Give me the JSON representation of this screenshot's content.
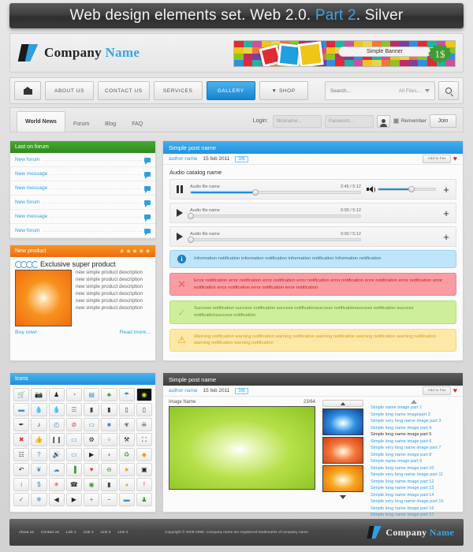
{
  "titlebar": {
    "part1": "Web design elements set. Web 2.0. ",
    "part2": "Part 2",
    "part3": ". Silver"
  },
  "brand": {
    "company": "Company ",
    "name": "Name"
  },
  "banner": {
    "caption": "Simple Banner",
    "price": "1$"
  },
  "nav": {
    "home_icon": "home-icon",
    "items": [
      {
        "label": "ABOUT US",
        "active": false
      },
      {
        "label": "CONTACT US",
        "active": false
      },
      {
        "label": "SERVICES",
        "active": false
      },
      {
        "label": "GALLERY",
        "active": true
      },
      {
        "label": "▼ SHOP",
        "active": false
      }
    ],
    "search_placeholder": "Search...",
    "filter_label": "All Files...",
    "search_icon": "magnifier-icon"
  },
  "tabs": {
    "items": [
      {
        "label": "World News",
        "active": true
      },
      {
        "label": "Forum",
        "active": false
      },
      {
        "label": "Blog",
        "active": false
      },
      {
        "label": "FAQ",
        "active": false
      }
    ],
    "login_label": "Login:",
    "nickname_placeholder": "Nickname...",
    "password_placeholder": "Password...",
    "remember_label": "Remember",
    "join_label": "Join"
  },
  "forum": {
    "title": "Last on forum",
    "items": [
      {
        "label": "New forum"
      },
      {
        "label": "New message"
      },
      {
        "label": "New message"
      },
      {
        "label": "New forum"
      },
      {
        "label": "New message"
      },
      {
        "label": "New forum"
      }
    ]
  },
  "product": {
    "title": "New product",
    "stars": 5,
    "headline": "Exclusive super product",
    "description": "new simple product description new simple product description new simple product description new simple product description new simple product description new simple product description",
    "buy_label": "Buy now!",
    "read_label": "Read more..."
  },
  "icons_panel": {
    "title": "Icons",
    "glyphs": [
      {
        "g": "🛒",
        "c": "#3b8fd0",
        "n": "cart-icon"
      },
      {
        "g": "📷",
        "c": "#3f9c35",
        "n": "camera-icon"
      },
      {
        "g": "♟",
        "c": "#222",
        "n": "chess-pawn-icon"
      },
      {
        "g": "◔",
        "c": "#3b8fd0",
        "n": "pie-chart-icon"
      },
      {
        "g": "▤",
        "c": "#3b8fd0",
        "n": "book-icon"
      },
      {
        "g": "♣",
        "c": "#3f9c35",
        "n": "tree-icon"
      },
      {
        "g": "☂",
        "c": "#3b8fd0",
        "n": "umbrella-icon"
      },
      {
        "g": "◉",
        "c": "#cde23a",
        "n": "eye-dark-icon",
        "dark": true
      },
      {
        "g": "▬",
        "c": "#3b8fd0",
        "n": "car-icon"
      },
      {
        "g": "💧",
        "c": "#3b8fd0",
        "n": "water-drop-icon"
      },
      {
        "g": "💧",
        "c": "#d33",
        "n": "blood-drop-icon"
      },
      {
        "g": "☰",
        "c": "#3b8fd0",
        "n": "document-icon"
      },
      {
        "g": "▮",
        "c": "#444",
        "n": "battery-icon"
      },
      {
        "g": "▮",
        "c": "#444",
        "n": "battery-full-icon"
      },
      {
        "g": "▯",
        "c": "#444",
        "n": "phone-icon"
      },
      {
        "g": "▯",
        "c": "#444",
        "n": "device-icon"
      },
      {
        "g": "✒",
        "c": "#222",
        "n": "pen-icon"
      },
      {
        "g": "♪",
        "c": "#222",
        "n": "music-note-icon"
      },
      {
        "g": "◴",
        "c": "#3b8fd0",
        "n": "clock-icon"
      },
      {
        "g": "⊘",
        "c": "#d33",
        "n": "forbidden-icon"
      },
      {
        "g": "▭",
        "c": "#3b8fd0",
        "n": "briefcase-icon"
      },
      {
        "g": "■",
        "c": "#3b8fd0",
        "n": "lock-icon"
      },
      {
        "g": "☣",
        "c": "#222",
        "n": "biohazard-icon"
      },
      {
        "g": "☠",
        "c": "#222",
        "n": "skull-icon"
      },
      {
        "g": "✖",
        "c": "#d33",
        "n": "close-icon"
      },
      {
        "g": "👍",
        "c": "#f0a020",
        "n": "thumbs-up-icon"
      },
      {
        "g": "❙❙",
        "c": "#222",
        "n": "pause-icon"
      },
      {
        "g": "▭",
        "c": "#3b8fd0",
        "n": "chat-bubble-icon"
      },
      {
        "g": "⚙",
        "c": "#222",
        "n": "gear-icon"
      },
      {
        "g": "♀",
        "c": "#3f9c35",
        "n": "person-icon"
      },
      {
        "g": "⚒",
        "c": "#222",
        "n": "tools-icon"
      },
      {
        "g": "⛶",
        "c": "#222",
        "n": "expand-icon"
      },
      {
        "g": "☷",
        "c": "#444",
        "n": "sliders-icon"
      },
      {
        "g": "?",
        "c": "#3b8fd0",
        "n": "question-icon"
      },
      {
        "g": "🔊",
        "c": "#222",
        "n": "speaker-icon"
      },
      {
        "g": "▭",
        "c": "#3b8fd0",
        "n": "card-icon"
      },
      {
        "g": "▶",
        "c": "#222",
        "n": "play-icon"
      },
      {
        "g": "◖",
        "c": "#3b8fd0",
        "n": "moon-icon"
      },
      {
        "g": "♻",
        "c": "#3f9c35",
        "n": "recycle-icon"
      },
      {
        "g": "◆",
        "c": "#f0a020",
        "n": "shield-icon"
      },
      {
        "g": "↶",
        "c": "#222",
        "n": "undo-icon"
      },
      {
        "g": "❦",
        "c": "#3b8fd0",
        "n": "tag-icon"
      },
      {
        "g": "☁",
        "c": "#3b8fd0",
        "n": "cloud-icon"
      },
      {
        "g": "▐",
        "c": "#3f9c35",
        "n": "bar-chart-icon"
      },
      {
        "g": "♥",
        "c": "#d33",
        "n": "heart-icon"
      },
      {
        "g": "⊖",
        "c": "#3f9c35",
        "n": "globe-icon"
      },
      {
        "g": "★",
        "c": "#f0a020",
        "n": "star-icon"
      },
      {
        "g": "▣",
        "c": "#222",
        "n": "video-camera-icon"
      },
      {
        "g": "i",
        "c": "#3b8fd0",
        "n": "info-icon"
      },
      {
        "g": "$",
        "c": "#3b8fd0",
        "n": "dollar-icon"
      },
      {
        "g": "✳",
        "c": "#d33",
        "n": "asterisk-icon"
      },
      {
        "g": "☎",
        "c": "#222",
        "n": "telephone-icon"
      },
      {
        "g": "◉",
        "c": "#3f9c35",
        "n": "eye-icon"
      },
      {
        "g": "▮",
        "c": "#444",
        "n": "trash-icon"
      },
      {
        "g": "◕",
        "c": "#f0a020",
        "n": "rss-icon"
      },
      {
        "g": "!",
        "c": "#d33",
        "n": "exclamation-icon"
      },
      {
        "g": "✓",
        "c": "#3f9c35",
        "n": "check-icon"
      },
      {
        "g": "❄",
        "c": "#3b8fd0",
        "n": "snowflake-icon"
      },
      {
        "g": "◀",
        "c": "#222",
        "n": "prev-icon"
      },
      {
        "g": "▶",
        "c": "#222",
        "n": "next-icon"
      },
      {
        "g": "+",
        "c": "#3f9c35",
        "n": "plus-icon"
      },
      {
        "g": "−",
        "c": "#d33",
        "n": "minus-icon"
      },
      {
        "g": "▬",
        "c": "#3b8fd0",
        "n": "save-icon"
      },
      {
        "g": "♟",
        "c": "#3f9c35",
        "n": "user-icon"
      }
    ]
  },
  "post": {
    "title": "Simple post name",
    "author": "author name",
    "date": "15 feb 2011",
    "comments": "185",
    "fav_label": "Add to Fav",
    "audio_section_title": "Audio catalog name",
    "tracks": [
      {
        "name": "Audio file name",
        "time": "2:45 / 5:12",
        "progress": 38,
        "state": "pause"
      },
      {
        "name": "Audio file name",
        "time": "0:00 / 5:12",
        "progress": 0,
        "state": "play"
      },
      {
        "name": "Audio file name",
        "time": "0:00 / 5:12",
        "progress": 0,
        "state": "play"
      }
    ],
    "volume": 58,
    "notifications": [
      {
        "type": "info",
        "text": "Information notification information notification information notification Information notification"
      },
      {
        "type": "error",
        "text": "Error notification error notification error notification error notification error notification error notification error notification error notification error notification error notification error notification"
      },
      {
        "type": "success",
        "text": "Success notification success notification success notificationsuccess notificationsuccess notification-success notificationsuccess notification"
      },
      {
        "type": "warning",
        "text": "Warning notification warning notification  warning notification warning notification warning notification warning notification warning notification warning notification"
      }
    ]
  },
  "gallery": {
    "title": "Simple post name",
    "author": "author name",
    "date": "15 feb 2011",
    "comments": "185",
    "fav_label": "Add to Fav",
    "image_label": "Image Name",
    "counter": "23/64",
    "items": [
      {
        "label": "Simple name image part 1",
        "current": false
      },
      {
        "label": "Simple long name imagepart 2",
        "current": false
      },
      {
        "label": "Simple very long name image part 3",
        "current": false
      },
      {
        "label": "Simple long name image part 4",
        "current": false
      },
      {
        "label": "Simple long name image part 5",
        "current": true
      },
      {
        "label": "Simple long name image part 6",
        "current": false
      },
      {
        "label": "Simple very long name image part 7",
        "current": false
      },
      {
        "label": "Simple long name image part 8",
        "current": false
      },
      {
        "label": "Simple name image part 9",
        "current": false
      },
      {
        "label": "Simple long name image part 10",
        "current": false
      },
      {
        "label": "Simple very long name image part 11",
        "current": false
      },
      {
        "label": "Simple long name image part 12",
        "current": false
      },
      {
        "label": "Simple long name image part 13",
        "current": false
      },
      {
        "label": "Simple long name image part 14",
        "current": false
      },
      {
        "label": "Simple very long name image part 15",
        "current": false
      },
      {
        "label": "Simple long name image part 16",
        "current": false
      },
      {
        "label": "Simple long name image part 17",
        "current": false
      }
    ]
  },
  "footer": {
    "links": [
      "About us",
      "Contact us",
      "Link 1",
      "Link 2",
      "Link 3",
      "Link 4"
    ],
    "copyright": "Copyright © 2008-2099. Company name are registered trademarks of company name",
    "company": "Company ",
    "name": "Name"
  },
  "colors": {
    "accent": "#2f9fe0",
    "green": "#3f9c35",
    "orange": "#f7921e",
    "red": "#e8232a"
  }
}
